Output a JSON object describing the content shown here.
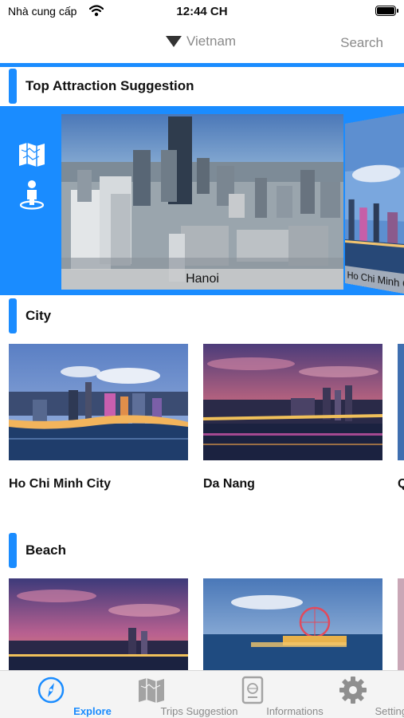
{
  "status_bar": {
    "carrier": "Nhà cung cấp",
    "time": "12:44 CH"
  },
  "nav": {
    "country": "Vietnam",
    "search_label": "Search"
  },
  "sections": {
    "top": {
      "title": "Top Attraction Suggestion"
    },
    "city": {
      "title": "City"
    },
    "beach": {
      "title": "Beach"
    }
  },
  "carousel": {
    "current": "Hanoi",
    "next": "Ho Chi Minh City"
  },
  "city_cards": [
    {
      "name": "Ho Chi Minh City"
    },
    {
      "name": "Da Nang"
    },
    {
      "name": "Q"
    }
  ],
  "tabs": [
    {
      "label": "Explore",
      "icon": "compass-icon",
      "active": true
    },
    {
      "label": "Trips Suggestion",
      "icon": "map-icon",
      "active": false
    },
    {
      "label": "Informations",
      "icon": "passport-icon",
      "active": false
    },
    {
      "label": "Settings",
      "icon": "gear-icon",
      "active": false
    }
  ],
  "colors": {
    "accent": "#1a8cff",
    "inactive": "#8a8a8a"
  }
}
